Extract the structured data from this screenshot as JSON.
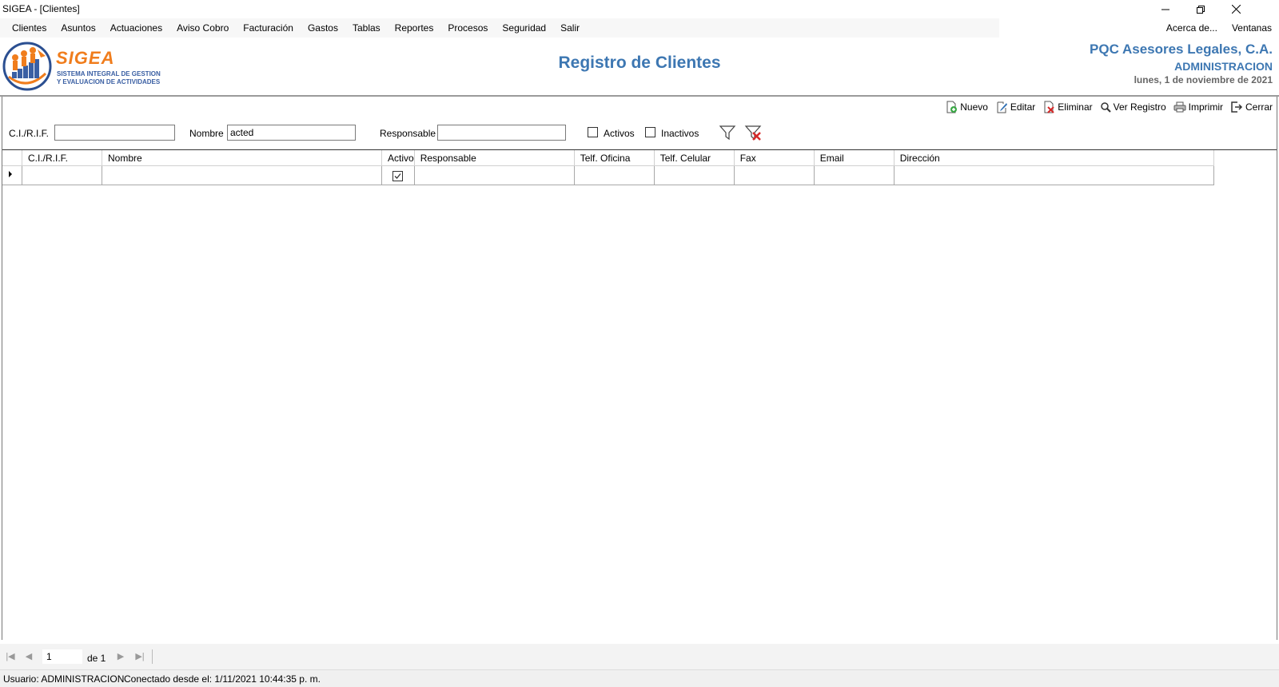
{
  "window": {
    "title": "SIGEA - [Clientes]"
  },
  "menu": {
    "left": [
      "Clientes",
      "Asuntos",
      "Actuaciones",
      "Aviso Cobro",
      "Facturación",
      "Gastos",
      "Tablas",
      "Reportes",
      "Procesos",
      "Seguridad",
      "Salir"
    ],
    "right": [
      "Acerca de...",
      "Ventanas"
    ]
  },
  "logo": {
    "brand": "SIGEA",
    "line1": "SISTEMA INTEGRAL DE GESTION",
    "line2": "Y EVALUACION DE ACTIVIDADES"
  },
  "header": {
    "page_title": "Registro de Clientes",
    "company": "PQC Asesores Legales, C.A.",
    "role": "ADMINISTRACION",
    "date": "lunes, 1 de noviembre de 2021"
  },
  "toolbar": {
    "nuevo": "Nuevo",
    "editar": "Editar",
    "eliminar": "Eliminar",
    "ver_registro": "Ver Registro",
    "imprimir": "Imprimir",
    "cerrar": "Cerrar"
  },
  "filters": {
    "cirif_label": "C.I./R.I.F.",
    "cirif_value": "",
    "nombre_label": "Nombre",
    "nombre_value": "acted",
    "responsable_label": "Responsable",
    "responsable_value": "",
    "activos_label": "Activos",
    "inactivos_label": "Inactivos"
  },
  "grid": {
    "columns": [
      "C.I./R.I.F.",
      "Nombre",
      "Activo",
      "Responsable",
      "Telf. Oficina",
      "Telf. Celular",
      "Fax",
      "Email",
      "Dirección"
    ],
    "rows": [
      {
        "cirif": "",
        "nombre": "",
        "activo": true,
        "responsable": "",
        "telf_oficina": "",
        "telf_celular": "",
        "fax": "",
        "email": "",
        "direccion": ""
      }
    ]
  },
  "navigator": {
    "current_page": "1",
    "of_label": "de 1"
  },
  "status": {
    "user": "Usuario: ADMINISTRACION",
    "connected": "Conectado desde el: 1/11/2021 10:44:35 p. m."
  },
  "colors": {
    "title_blue": "#3d77b2",
    "brand_orange": "#f07d1d",
    "logo_blue": "#3a5fa3"
  }
}
